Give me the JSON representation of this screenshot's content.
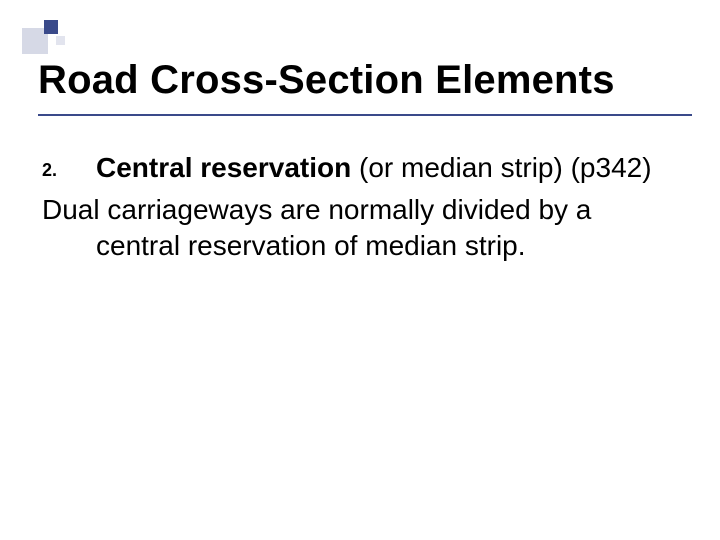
{
  "title": "Road Cross-Section Elements",
  "item": {
    "number": "2.",
    "term": "Central reservation",
    "qualifier": " (or median strip) (p342)"
  },
  "paragraph_line1": "Dual carriageways are normally divided by a",
  "paragraph_line2": "central reservation of median strip."
}
